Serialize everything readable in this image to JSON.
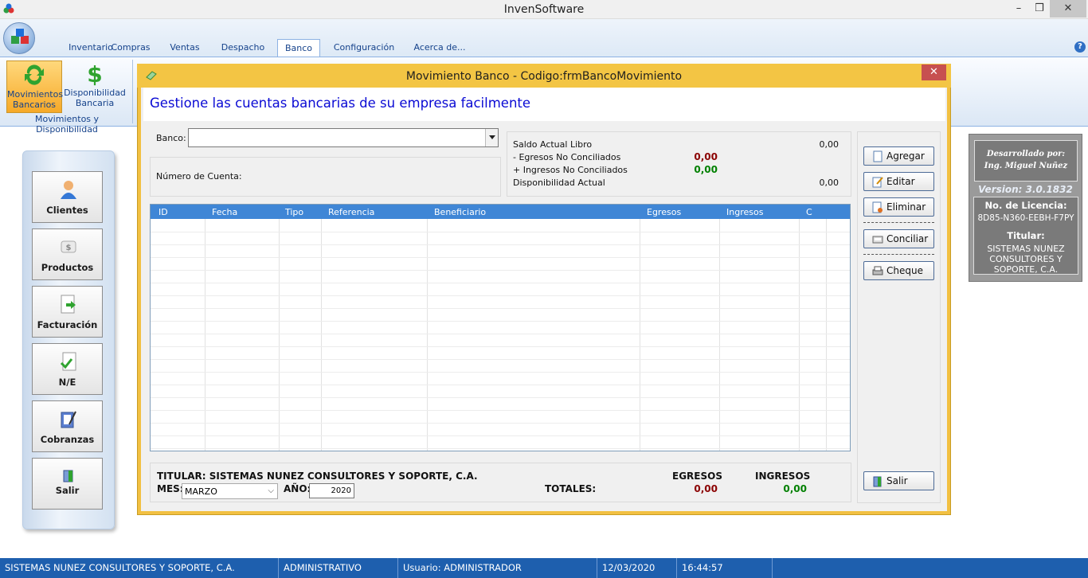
{
  "app": {
    "title": "InvenSoftware"
  },
  "window_controls": {
    "minimize": "–",
    "maximize": "❒",
    "close": "✕"
  },
  "tabs": [
    "Inventario",
    "Compras",
    "Ventas",
    "Despacho",
    "Banco",
    "Configuración",
    "Acerca de..."
  ],
  "active_tab": "Banco",
  "ribbon": {
    "btn1_line1": "Movimientos",
    "btn1_line2": "Bancarios",
    "btn2_line1": "Disponibilidad",
    "btn2_line2": "Bancaria",
    "group_label": "Movimientos y Disponibilidad"
  },
  "sidebar": {
    "items": [
      "Clientes",
      "Productos",
      "Facturación",
      "N/E",
      "Cobranzas",
      "Salir"
    ]
  },
  "dialog": {
    "title": "Movimiento Banco - Codigo:frmBancoMovimiento",
    "headline": "Gestione las cuentas bancarias de su empresa facilmente",
    "banco_label": "Banco:",
    "banco_value": "",
    "cuenta_label": "Número de Cuenta:",
    "saldo": {
      "libro_label": "Saldo Actual Libro",
      "libro_value": "0,00",
      "egresos_nc_label": "- Egresos No Conciliados",
      "egresos_nc_value": "0,00",
      "ingresos_nc_label": "+ Ingresos No Conciliados",
      "ingresos_nc_value": "0,00",
      "disponibilidad_label": "Disponibilidad Actual",
      "disponibilidad_value": "0,00"
    },
    "grid_columns": [
      "ID",
      "Fecha",
      "Tipo",
      "Referencia",
      "Beneficiario",
      "Egresos",
      "Ingresos",
      "C"
    ],
    "buttons": {
      "agregar": "Agregar",
      "editar": "Editar",
      "eliminar": "Eliminar",
      "conciliar": "Conciliar",
      "cheque": "Cheque",
      "salir": "Salir"
    },
    "footer": {
      "titular": "TITULAR: SISTEMAS NUNEZ CONSULTORES Y SOPORTE, C.A.",
      "mes_label": "MES:",
      "mes_value": "MARZO",
      "anio_label": "AÑO:",
      "anio_value": "2020",
      "totales_label": "TOTALES:",
      "egresos_label": "EGRESOS",
      "egresos_value": "0,00",
      "ingresos_label": "INGRESOS",
      "ingresos_value": "0,00"
    }
  },
  "info_panel": {
    "dev_line1": "Desarrollado por:",
    "dev_line2": "Ing. Miguel Nuñez",
    "version": "Version: 3.0.1832",
    "license_label": "No. de Licencia:",
    "license_value": "8D85-N360-EEBH-F7PY",
    "titular_label": "Titular:",
    "titular_value": "SISTEMAS NUNEZ CONSULTORES Y SOPORTE, C.A."
  },
  "status_bar": {
    "company": "SISTEMAS NUNEZ CONSULTORES Y SOPORTE, C.A.",
    "role": "ADMINISTRATIVO",
    "user": "Usuario: ADMINISTRADOR",
    "date": "12/03/2020",
    "time": "16:44:57"
  },
  "colors": {
    "accent": "#f3c544",
    "grid_header": "#3f86d6",
    "status_bar": "#1e5fae",
    "negative": "#8b0000",
    "positive": "#008000"
  }
}
